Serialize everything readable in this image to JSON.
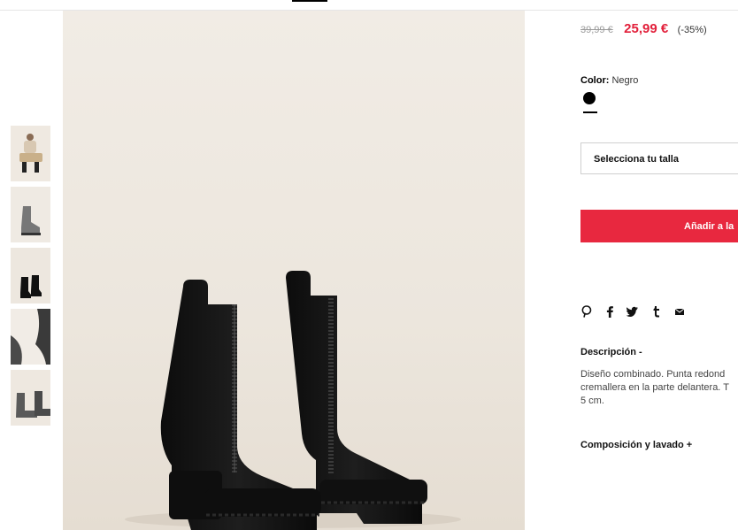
{
  "product": {
    "old_price": "39,99 €",
    "new_price": "25,99 €",
    "discount": "(-35%)",
    "color_label": "Color:",
    "color_value": "Negro",
    "size_placeholder": "Selecciona tu talla",
    "add_button": "Añadir a la",
    "description_title": "Descripción -",
    "description_lines": [
      "Diseño combinado. Punta redond",
      "cremallera en la parte delantera. T",
      "5 cm."
    ],
    "composition_title": "Composición y lavado +"
  },
  "share_icons": [
    "pinterest-icon",
    "facebook-icon",
    "twitter-icon",
    "tumblr-icon",
    "mail-icon"
  ],
  "thumbnails": [
    "model-seated",
    "boot-side-view",
    "boots-pair-front",
    "boot-closeup",
    "boots-pair-back"
  ],
  "colors": {
    "accent": "#e8283f",
    "price_red": "#e2203b",
    "swatch": "#000000"
  }
}
